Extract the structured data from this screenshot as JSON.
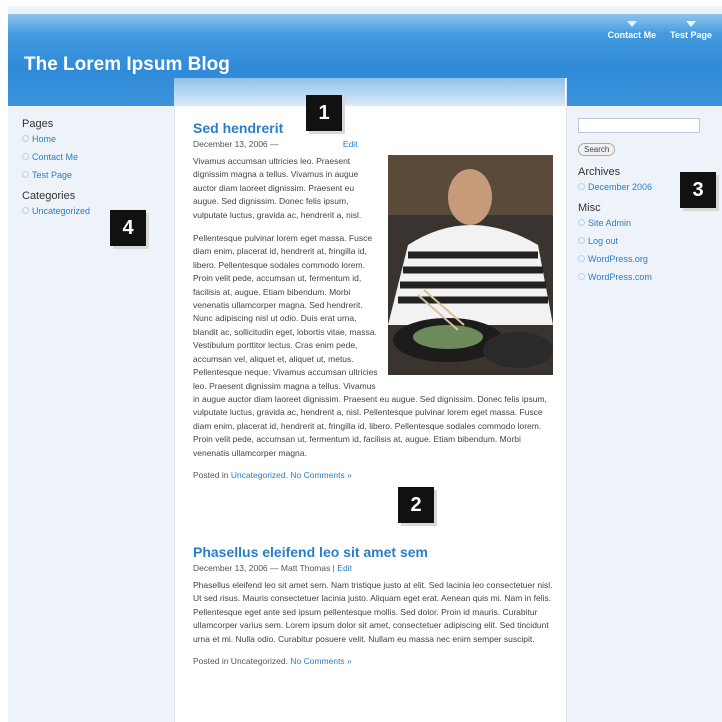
{
  "header": {
    "blog_title": "The Lorem Ipsum Blog",
    "nav": [
      {
        "label": "Contact Me"
      },
      {
        "label": "Test Page"
      }
    ]
  },
  "sidebar_left": {
    "pages_heading": "Pages",
    "pages": [
      {
        "label": "Home"
      },
      {
        "label": "Contact Me"
      },
      {
        "label": "Test Page"
      }
    ],
    "categories_heading": "Categories",
    "categories": [
      {
        "label": "Uncategorized"
      }
    ]
  },
  "sidebar_right": {
    "search_button": "Search",
    "search_value": "",
    "archives_heading": "Archives",
    "archives": [
      {
        "label": "December 2006"
      }
    ],
    "misc_heading": "Misc",
    "misc": [
      {
        "label": "Site Admin"
      },
      {
        "label": "Log out"
      },
      {
        "label": "WordPress.org"
      },
      {
        "label": "WordPress.com"
      }
    ]
  },
  "posts": [
    {
      "title": "Sed hendrerit",
      "date": "December 13, 2006 —",
      "edit_label": "Edit",
      "p1": "Vivamus accumsan ultricies leo. Praesent dignissim magna a tellus. Vivamus in augue auctor diam laoreet dignissim. Praesent eu augue. Sed dignissim. Donec felis ipsum, vulputate luctus, gravida ac, hendrerit a, nisl.",
      "p2": "Pellentesque pulvinar lorem eget massa. Fusce diam enim, placerat id, hendrerit at, fringilla id, libero. Pellentesque sodales commodo lorem. Proin velit pede, accumsan ut, fermentum id, facilisis at, augue. Etiam bibendum. Morbi venenatis ullamcorper magna. Sed hendrerit. Nunc adipiscing nisl ut odio. Duis erat urna, blandit ac, sollicitudin eget, lobortis vitae, massa. Vestibulum porttitor lectus. Cras enim pede, accumsan vel, aliquet et, aliquet ut, metus. Pellentesque neque. Vivamus accumsan ultricies leo. Praesent dignissim magna a tellus. Vivamus in augue auctor diam laoreet dignissim. Praesent eu augue. Sed dignissim. Donec felis ipsum, vulputate luctus, gravida ac, hendrerit a, nisl. Pellentesque pulvinar lorem eget massa. Fusce diam enim, placerat id, hendrerit at, fringilla id, libero. Pellentesque sodales commodo lorem. Proin velit pede, accumsan ut, fermentum id, facilisis at, augue. Etiam bibendum. Morbi venenatis ullamcorper magna.",
      "posted_in": "Posted in",
      "category": "Uncategorized",
      "comments": "No Comments »"
    },
    {
      "title": "Phasellus eleifend leo sit amet sem",
      "date": "December 13, 2006 — Matt Thomas |",
      "edit_label": "Edit",
      "p1": "Phasellus eleifend leo sit amet sem. Nam tristique justo at elit. Sed lacinia leo consectetuer nisl. Ut sed risus. Mauris consectetuer lacinia justo. Aliquam eget erat. Aenean quis mi. Nam in felis. Pellentesque eget ante sed ipsum pellentesque mollis. Sed dolor. Proin id mauris. Curabitur ullamcorper varius sem. Lorem ipsum dolor sit amet, consectetuer adipiscing elit. Sed tincidunt urna et mi. Nulla odio. Curabitur posuere velit. Nullam eu massa nec enim semper suscipit.",
      "posted_in": "Posted in Uncategorized.",
      "comments": "No Comments »"
    }
  ],
  "callouts": [
    "1",
    "2",
    "3",
    "4"
  ]
}
